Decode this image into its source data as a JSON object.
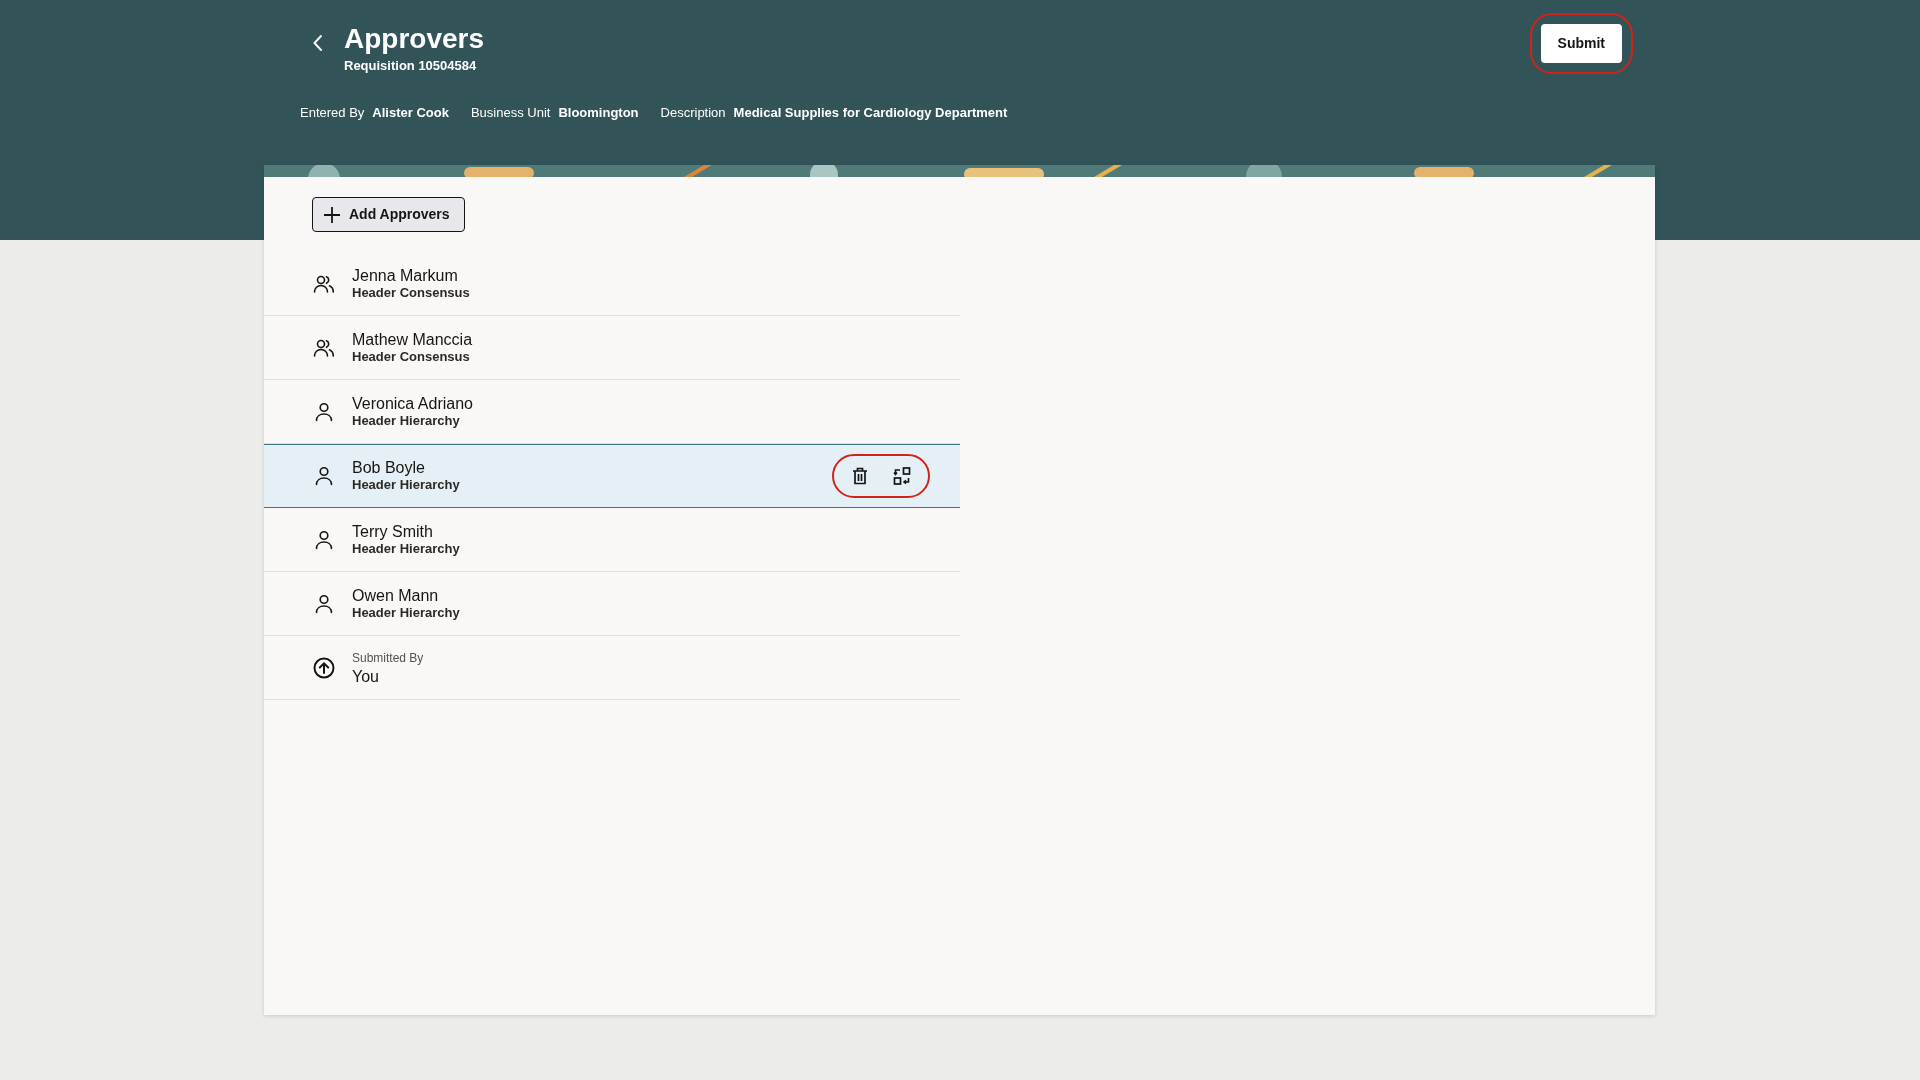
{
  "header": {
    "title": "Approvers",
    "subtitle": "Requisition 10504584",
    "fields": [
      {
        "label": "Entered By",
        "value": "Alister Cook"
      },
      {
        "label": "Business Unit",
        "value": "Bloomington"
      },
      {
        "label": "Description",
        "value": "Medical Supplies for Cardiology Department"
      }
    ],
    "submit": {
      "label": "Submit",
      "highlighted": true
    }
  },
  "add_button": {
    "label": "Add Approvers"
  },
  "approvers": [
    {
      "kind": "group",
      "name": "Jenna Markum",
      "role": "Header Consensus",
      "selected": false
    },
    {
      "kind": "group",
      "name": "Mathew Manccia",
      "role": "Header Consensus",
      "selected": false
    },
    {
      "kind": "person",
      "name": "Veronica Adriano",
      "role": "Header Hierarchy",
      "selected": false
    },
    {
      "kind": "person",
      "name": "Bob Boyle",
      "role": "Header Hierarchy",
      "selected": true,
      "actions_highlighted": true
    },
    {
      "kind": "person",
      "name": "Terry Smith",
      "role": "Header Hierarchy",
      "selected": false
    },
    {
      "kind": "person",
      "name": "Owen Mann",
      "role": "Header Hierarchy",
      "selected": false
    },
    {
      "kind": "submitter",
      "label": "Submitted By",
      "name": "You"
    }
  ]
}
